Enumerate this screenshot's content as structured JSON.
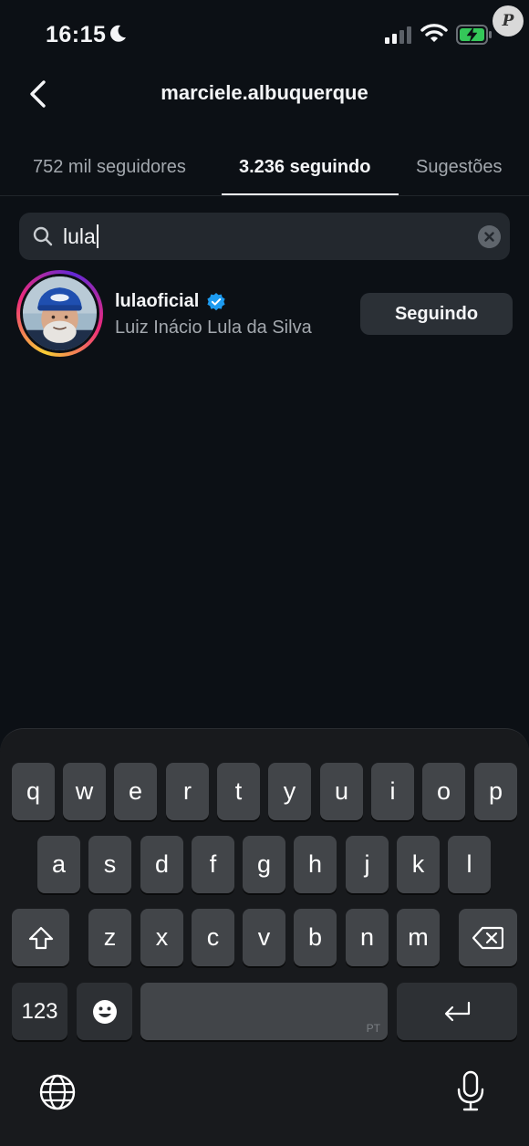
{
  "status_bar": {
    "time": "16:15",
    "icons": [
      "moon-icon",
      "signal-icon",
      "wifi-icon",
      "battery-charging-icon"
    ],
    "watermark": "P"
  },
  "header": {
    "title": "marciele.albuquerque",
    "back_icon": "chevron-left-icon"
  },
  "tabs": [
    {
      "label": "752 mil seguidores",
      "active": false
    },
    {
      "label": "3.236 seguindo",
      "active": true
    },
    {
      "label": "Sugestões",
      "active": false
    }
  ],
  "search": {
    "value": "lula",
    "icon": "search-icon",
    "clear_icon": "clear-icon"
  },
  "results": [
    {
      "username": "lulaoficial",
      "verified": true,
      "full_name": "Luiz Inácio Lula da Silva",
      "button_label": "Seguindo"
    }
  ],
  "keyboard": {
    "row1": [
      "q",
      "w",
      "e",
      "r",
      "t",
      "y",
      "u",
      "i",
      "o",
      "p"
    ],
    "row2": [
      "a",
      "s",
      "d",
      "f",
      "g",
      "h",
      "j",
      "k",
      "l"
    ],
    "row3": [
      "z",
      "x",
      "c",
      "v",
      "b",
      "n",
      "m"
    ],
    "numbers_label": "123",
    "space_lang": "PT",
    "icons": [
      "shift-icon",
      "backspace-icon",
      "emoji-icon",
      "return-icon",
      "globe-icon",
      "microphone-icon"
    ]
  },
  "colors": {
    "background": "#0c1015",
    "verified": "#1d9bf0",
    "battery": "#34c759"
  }
}
